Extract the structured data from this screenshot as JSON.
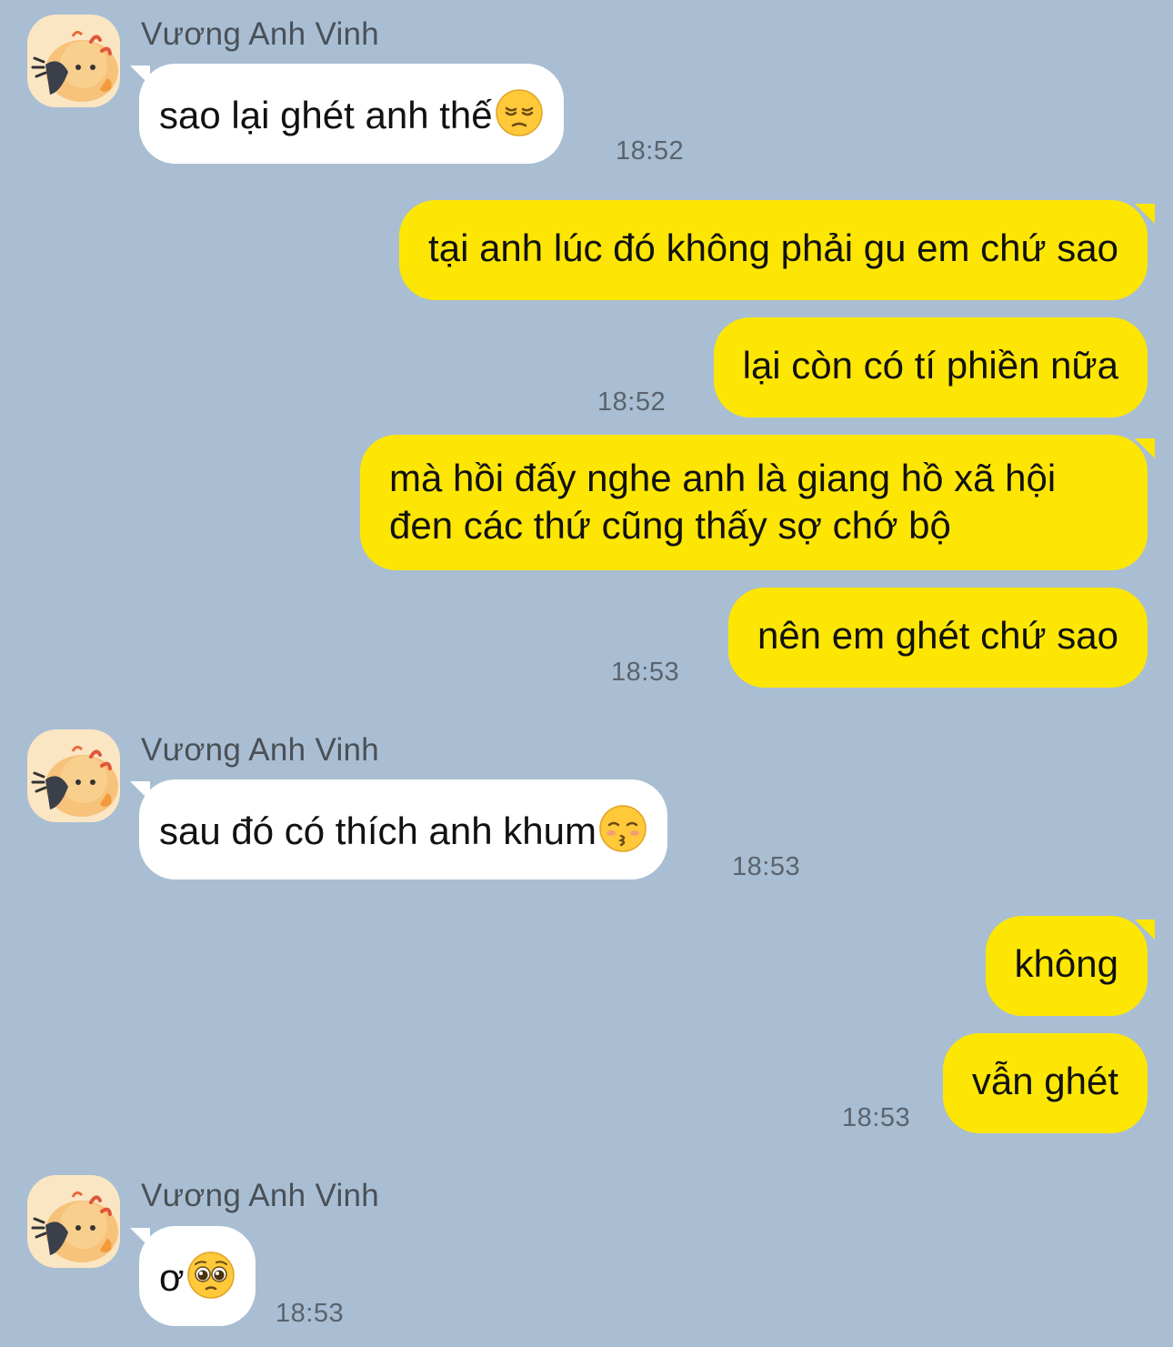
{
  "messages": [
    {
      "sender": "Vương Anh Vinh",
      "text": "sao lại ghét anh thế",
      "emoji": "pensive-face-emoji",
      "time": "18:52"
    },
    {
      "text": "tại anh lúc đó không phải gu em chứ sao"
    },
    {
      "text": "lại còn có tí phiền nữa",
      "time": "18:52"
    },
    {
      "line1": "mà hồi đấy nghe anh là giang hồ xã hội",
      "line2": "đen các thứ cũng thấy sợ chớ bộ"
    },
    {
      "text": "nên em ghét chứ sao",
      "time": "18:53"
    },
    {
      "sender": "Vương Anh Vinh",
      "text": "sau đó có thích anh khum",
      "emoji": "kissing-closed-eyes-emoji",
      "time": "18:53"
    },
    {
      "text": "không"
    },
    {
      "text": "vẫn ghét",
      "time": "18:53"
    },
    {
      "sender": "Vương Anh Vinh",
      "text": "ơ",
      "emoji": "pleading-face-emoji",
      "time": "18:53"
    }
  ],
  "colors": {
    "background": "#a9bed2",
    "incoming_bubble": "#ffffff",
    "outgoing_bubble": "#fde603"
  }
}
